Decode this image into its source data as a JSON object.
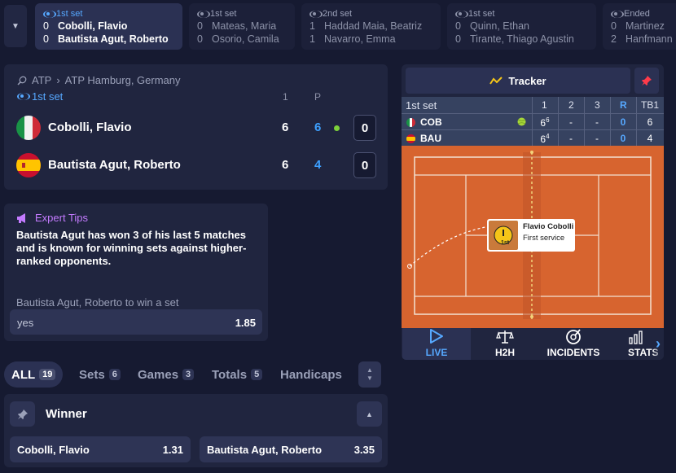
{
  "topbar": {
    "matches": [
      {
        "status": "1st set",
        "live": true,
        "active": true,
        "p1": {
          "score": "0",
          "name": "Cobolli, Flavio"
        },
        "p2": {
          "score": "0",
          "name": "Bautista Agut, Roberto"
        }
      },
      {
        "status": "1st set",
        "live": true,
        "active": false,
        "p1": {
          "score": "0",
          "name": "Mateas, Maria"
        },
        "p2": {
          "score": "0",
          "name": "Osorio, Camila"
        }
      },
      {
        "status": "2nd set",
        "live": true,
        "active": false,
        "p1": {
          "score": "1",
          "name": "Haddad Maia, Beatriz"
        },
        "p2": {
          "score": "1",
          "name": "Navarro, Emma"
        }
      },
      {
        "status": "1st set",
        "live": true,
        "active": false,
        "p1": {
          "score": "0",
          "name": "Quinn, Ethan"
        },
        "p2": {
          "score": "0",
          "name": "Tirante, Thiago Agustin"
        }
      },
      {
        "status": "Ended",
        "live": true,
        "active": false,
        "p1": {
          "score": "0",
          "name": "Martinez"
        },
        "p2": {
          "score": "2",
          "name": "Hanfmann"
        }
      }
    ]
  },
  "scoreboard": {
    "tour": "ATP",
    "event": "ATP Hamburg, Germany",
    "set_status": "1st set",
    "col_set": "1",
    "col_points": "P",
    "players": [
      {
        "name": "Cobolli, Flavio",
        "set1": "6",
        "points": "6",
        "game": "0",
        "serving": true,
        "flag": "italy"
      },
      {
        "name": "Bautista Agut, Roberto",
        "set1": "6",
        "points": "4",
        "game": "0",
        "serving": false,
        "flag": "spain"
      }
    ]
  },
  "tips": {
    "heading": "Expert Tips",
    "text": "Bautista Agut has won 3 of his last 5 matches and is known for winning sets against higher-ranked opponents.",
    "selection": "Bautista Agut, Roberto to win a set",
    "option_label": "yes",
    "option_odds": "1.85"
  },
  "filters": [
    {
      "label": "ALL",
      "count": "19",
      "active": true
    },
    {
      "label": "Sets",
      "count": "6",
      "active": false
    },
    {
      "label": "Games",
      "count": "3",
      "active": false
    },
    {
      "label": "Totals",
      "count": "5",
      "active": false
    },
    {
      "label": "Handicaps",
      "count": "",
      "active": false
    }
  ],
  "market": {
    "title": "Winner",
    "outcomes": [
      {
        "label": "Cobolli, Flavio",
        "odds": "1.31"
      },
      {
        "label": "Bautista Agut, Roberto",
        "odds": "3.35"
      }
    ]
  },
  "tracker": {
    "title": "Tracker",
    "set_label": "1st set",
    "headers": [
      "1",
      "2",
      "3",
      "R",
      "TB1"
    ],
    "rows": [
      {
        "abbr": "COB",
        "flag": "italy",
        "serving": true,
        "set1": "6",
        "set1_sup": "6",
        "set2": "-",
        "set3": "-",
        "r": "0",
        "tb1": "6"
      },
      {
        "abbr": "BAU",
        "flag": "spain",
        "serving": false,
        "set1": "6",
        "set1_sup": "4",
        "set2": "-",
        "set3": "-",
        "r": "0",
        "tb1": "4"
      }
    ],
    "popup": {
      "player": "Flavio Cobolli",
      "event": "First service",
      "badge": "1st"
    },
    "tabs": [
      {
        "label": "LIVE",
        "icon": "play-icon",
        "active": true
      },
      {
        "label": "H2H",
        "icon": "scales-icon",
        "active": false
      },
      {
        "label": "INCIDENTS",
        "icon": "incidents-icon",
        "active": false
      },
      {
        "label": "STATS",
        "icon": "stats-icon",
        "active": false
      }
    ]
  },
  "colors": {
    "bg": "#161a31",
    "panel": "#20253f",
    "accent_blue": "#3da0ff",
    "live_blue": "#56a8ff",
    "purple": "#c47bff",
    "clay": "#d7642f",
    "pin_red": "#ff3b4a",
    "serve_green": "#7dd13a"
  }
}
